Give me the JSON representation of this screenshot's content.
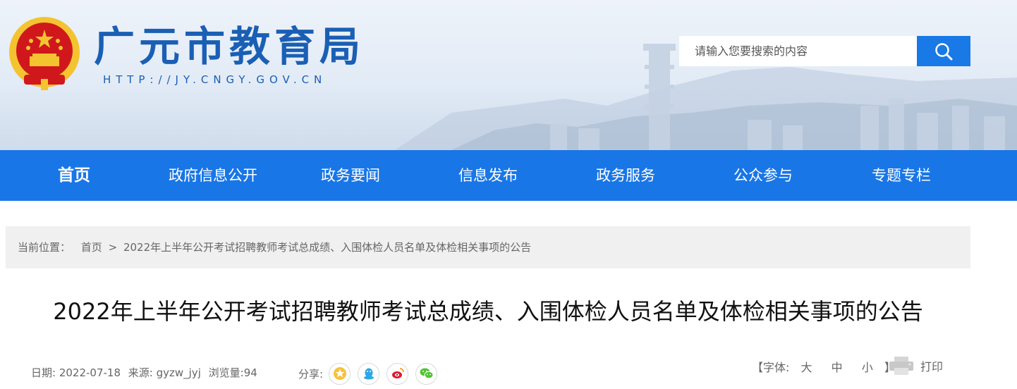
{
  "header": {
    "site_title": "广元市教育局",
    "site_url": "HTTP://JY.CNGY.GOV.CN",
    "search": {
      "placeholder": "请输入您要搜索的内容"
    }
  },
  "nav": {
    "items": [
      {
        "label": "首页",
        "active": true
      },
      {
        "label": "政府信息公开"
      },
      {
        "label": "政务要闻"
      },
      {
        "label": "信息发布"
      },
      {
        "label": "政务服务"
      },
      {
        "label": "公众参与"
      },
      {
        "label": "专题专栏"
      }
    ]
  },
  "breadcrumb": {
    "prefix": "当前位置：",
    "home": "首页",
    "separator": ">",
    "current": "2022年上半年公开考试招聘教师考试总成绩、入围体检人员名单及体检相关事项的公告"
  },
  "article": {
    "title": "2022年上半年公开考试招聘教师考试总成绩、入围体检人员名单及体检相关事项的公告",
    "date": "日期: 2022-07-18",
    "source": "来源: gyzw_jyj",
    "views": "浏览量:94",
    "share_label": "分享:",
    "share_icons": [
      "star-icon",
      "qq-icon",
      "weibo-icon",
      "wechat-icon"
    ],
    "font_prefix": "【字体:",
    "font_large": "大",
    "font_medium": "中",
    "font_small": "小",
    "font_suffix": "】",
    "print_label": "打印"
  },
  "colors": {
    "brand": "#1976e6",
    "title_blue": "#1a5fb4",
    "emblem_red": "#d0181c",
    "gold": "#f4c430"
  }
}
